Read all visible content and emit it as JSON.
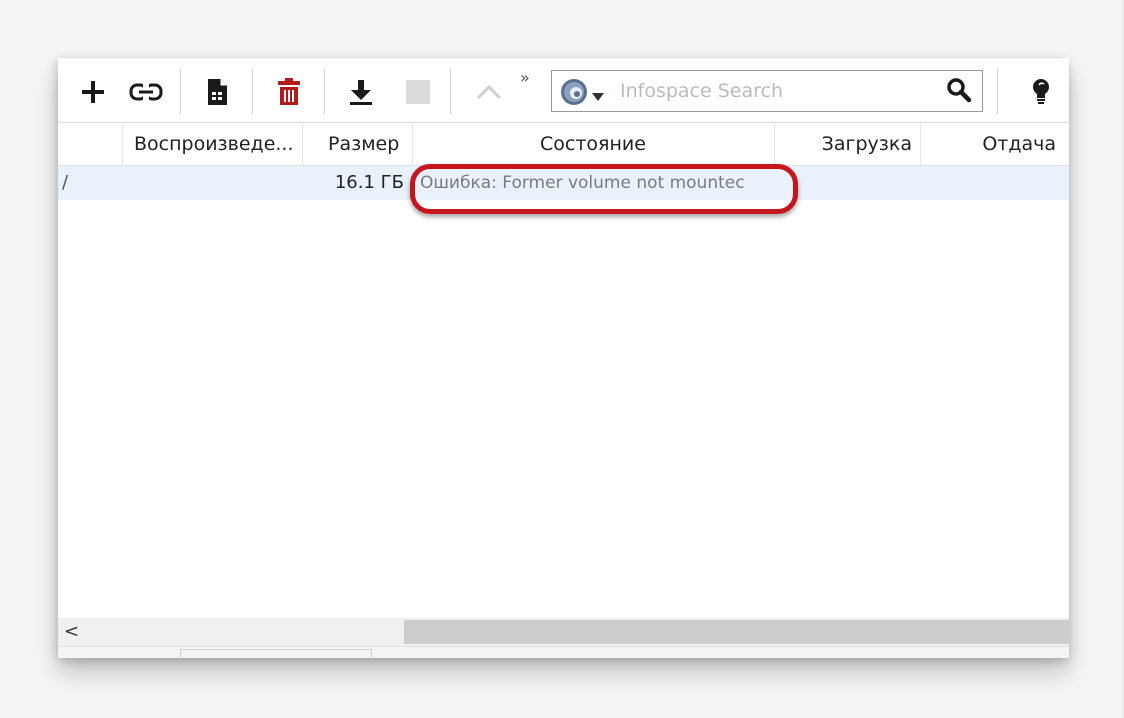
{
  "toolbar": {
    "buttons": [
      {
        "name": "add-torrent-button",
        "icon": "plus-icon"
      },
      {
        "name": "add-link-button",
        "icon": "link-icon"
      },
      {
        "name": "create-torrent-button",
        "icon": "file-icon"
      },
      {
        "name": "remove-button",
        "icon": "trash-icon"
      },
      {
        "name": "start-download-button",
        "icon": "download-arrow-icon"
      },
      {
        "name": "stop-button",
        "icon": "stop-square-icon"
      },
      {
        "name": "move-up-button",
        "icon": "chevron-up-icon"
      },
      {
        "name": "tips-button",
        "icon": "lightbulb-icon"
      }
    ],
    "overflow": "»"
  },
  "search": {
    "engine_icon": "infospace-globe-icon",
    "placeholder": "Infospace Search",
    "value": ""
  },
  "columns": [
    {
      "key": "play",
      "label": "Воспроизведе..."
    },
    {
      "key": "size",
      "label": "Размер"
    },
    {
      "key": "status",
      "label": "Состояние"
    },
    {
      "key": "download",
      "label": "Загрузка"
    },
    {
      "key": "upload",
      "label": "Отдача"
    }
  ],
  "rows": [
    {
      "name_fragment": "/",
      "play": "",
      "size": "16.1 ГБ",
      "status": "Ошибка: Former volume not mountec",
      "download": "",
      "upload": ""
    }
  ],
  "scrollbar": {
    "left_arrow": "<"
  },
  "colors": {
    "selected_row": "#e9f1fb",
    "highlight": "#c4161c",
    "trash": "#b31b1b",
    "status_text": "#7b7b7b"
  }
}
